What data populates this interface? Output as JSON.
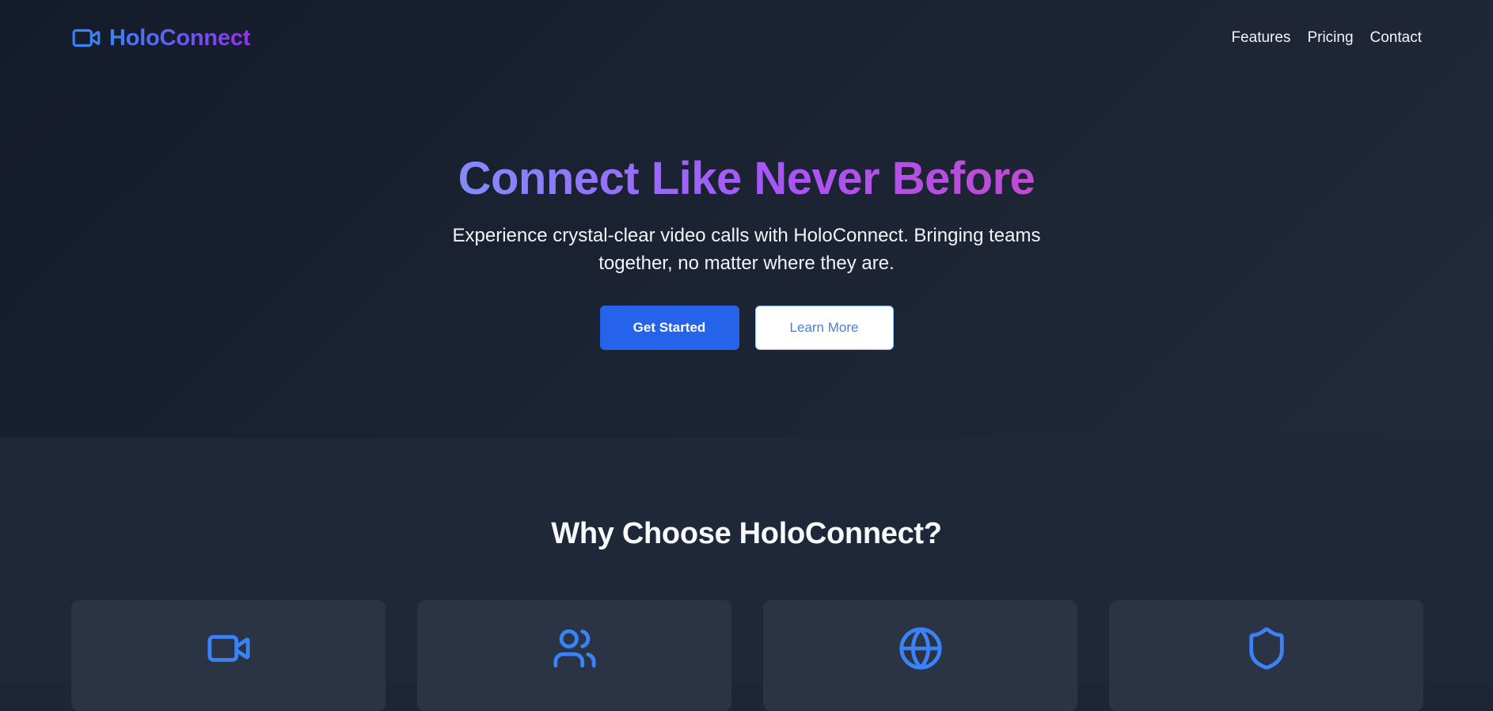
{
  "nav": {
    "brand": "HoloConnect",
    "brand_icon": "video-camera-icon",
    "links": [
      "Features",
      "Pricing",
      "Contact"
    ]
  },
  "hero": {
    "title": "Connect Like Never Before",
    "subtitle": "Experience crystal-clear video calls with HoloConnect. Bringing teams together, no matter where they are.",
    "primary_button": "Get Started",
    "secondary_button": "Learn More"
  },
  "features": {
    "title": "Why Choose HoloConnect?",
    "cards": [
      {
        "icon": "video-camera-icon"
      },
      {
        "icon": "users-icon"
      },
      {
        "icon": "globe-icon"
      },
      {
        "icon": "shield-icon"
      }
    ]
  },
  "colors": {
    "accent_blue": "#3b82f6",
    "primary_button": "#2563eb",
    "gradient_purple": "#a855f7",
    "background": "#1b2333",
    "card": "#2b3445"
  }
}
